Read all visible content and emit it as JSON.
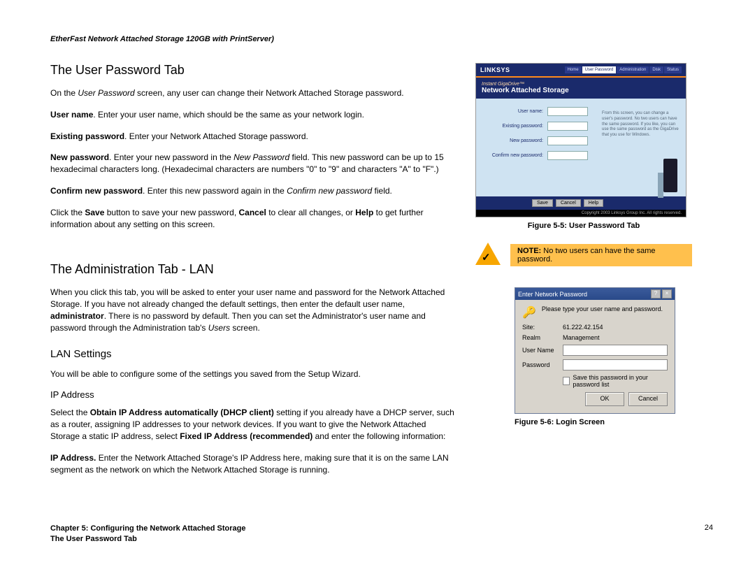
{
  "header": "EtherFast Network Attached Storage 120GB with PrintServer)",
  "section1": {
    "title": "The User Password Tab",
    "p1_a": "On the ",
    "p1_b": "User Password",
    "p1_c": " screen, any user can change their Network Attached Storage password.",
    "p2_a": "User name",
    "p2_b": ". Enter your user name, which should be the same as your network login.",
    "p3_a": "Existing password",
    "p3_b": ". Enter your Network Attached Storage password.",
    "p4_a": "New password",
    "p4_b": ". Enter your new password in the ",
    "p4_c": "New Password",
    "p4_d": " field. This new password can be up to 15 hexadecimal characters long. (Hexadecimal characters are numbers \"0\" to \"9\" and characters \"A\" to \"F\".)",
    "p5_a": "Confirm new password",
    "p5_b": ". Enter this new password again in the ",
    "p5_c": "Confirm new password",
    "p5_d": " field.",
    "p6_a": "Click the ",
    "p6_b": "Save",
    "p6_c": " button to save your new password, ",
    "p6_d": "Cancel",
    "p6_e": " to clear all changes, or ",
    "p6_f": "Help",
    "p6_g": " to get further information about any setting on this screen."
  },
  "section2": {
    "title": "The Administration Tab - LAN",
    "p1_a": "When you click this tab, you will be asked to enter your user name and password for the Network Attached Storage. If you have not already changed the default settings, then enter the default user name, ",
    "p1_b": "administrator",
    "p1_c": ". There is no password by default. Then you can set the Administrator's user name and password through the Administration tab's ",
    "p1_d": "Users",
    "p1_e": " screen.",
    "sub1": "LAN Settings",
    "p2": "You will be able to configure some of the settings you saved from the Setup Wizard.",
    "sub2": "IP Address",
    "p3_a": "Select the ",
    "p3_b": "Obtain IP Address automatically (DHCP client)",
    "p3_c": " setting if you already have a DHCP server, such as a router, assigning IP addresses to your network devices. If you want to give the Network Attached Storage a static IP address, select ",
    "p3_d": "Fixed IP Address (recommended)",
    "p3_e": " and enter the following information:",
    "p4_a": "IP Address.",
    "p4_b": " Enter the Network Attached Storage's IP Address here, making sure that it is on the same LAN segment as the network on which the Network Attached Storage is running."
  },
  "fig55": {
    "caption": "Figure 5-5: User Password Tab",
    "logo": "LINKSYS",
    "tabs": [
      "Home",
      "User Password",
      "Administration",
      "Disk",
      "Status"
    ],
    "active_tab_index": 1,
    "sub_small": "Instant GigaDrive™",
    "sub_big": "Network Attached Storage",
    "rows": [
      "User name:",
      "Existing password:",
      "New password:",
      "Confirm new password:"
    ],
    "desc": "From this screen, you can change a user's password. No two users can have the same password. If you like, you can use the same password as the GigaDrive that you use for Windows.",
    "btns": [
      "Save",
      "Cancel",
      "Help"
    ],
    "foot": "Copyright 2003 Linksys Group Inc. All rights reserved."
  },
  "note": {
    "label": "NOTE:",
    "text": "  No two users can have the same password."
  },
  "fig56": {
    "caption": "Figure 5-6: Login Screen",
    "title": "Enter Network Password",
    "prompt": "Please type your user name and password.",
    "rows": {
      "site_lbl": "Site:",
      "site_val": "61.222.42.154",
      "realm_lbl": "Realm",
      "realm_val": "Management",
      "user_lbl": "User Name",
      "pass_lbl": "Password"
    },
    "checkbox": "Save this password in your password list",
    "ok": "OK",
    "cancel": "Cancel"
  },
  "footer": {
    "chapter": "Chapter 5: Configuring the Network Attached Storage",
    "sub": "The User Password Tab",
    "page": "24"
  }
}
